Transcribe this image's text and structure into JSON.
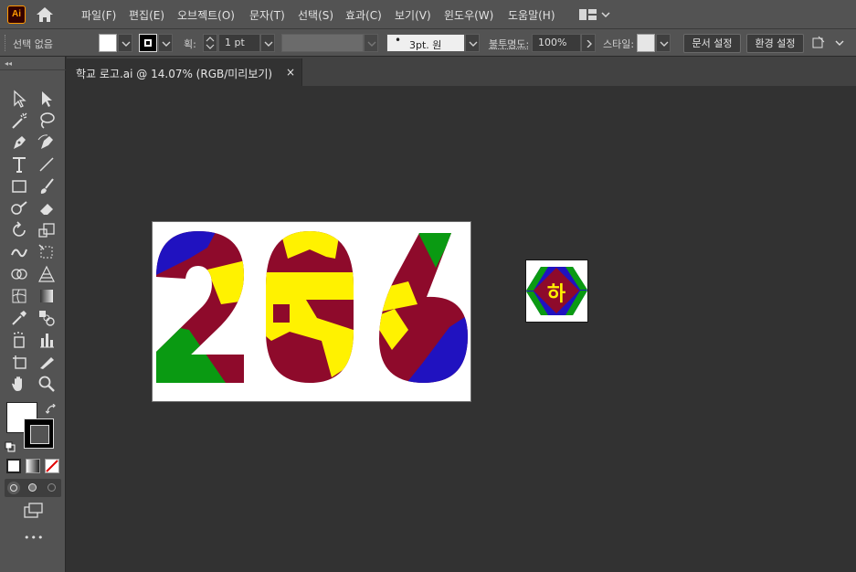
{
  "app": {
    "logo_text": "Ai",
    "brand_color": "#ff9a00"
  },
  "menu": [
    "파일(F)",
    "편집(E)",
    "오브젝트(O)",
    "문자(T)",
    "선택(S)",
    "효과(C)",
    "보기(V)",
    "윈도우(W)",
    "도움말(H)"
  ],
  "control_bar": {
    "selection_status": "선택 없음",
    "stroke_label": "획:",
    "stroke_weight": "1 pt",
    "brush_preset": "3pt. 원",
    "opacity_label": "불투명도:",
    "opacity_value": "100%",
    "style_label": "스타일:",
    "document_setup_button": "문서 설정",
    "preferences_button": "환경 설정"
  },
  "document_tab": {
    "title": "학교 로고.ai @ 14.07% (RGB/미리보기)",
    "close_glyph": "×"
  },
  "tool_panel": {
    "collapse_glyph": "◂◂",
    "more_tools_glyph": "•••",
    "fill_color": "#ffffff",
    "stroke_color": "#000000"
  },
  "artwork": {
    "main_text": "206",
    "palette": {
      "blue": "#2012c0",
      "maroon": "#8e0a2b",
      "yellow": "#fff200",
      "green": "#0a9a12"
    },
    "emblem_glyph": "하"
  }
}
